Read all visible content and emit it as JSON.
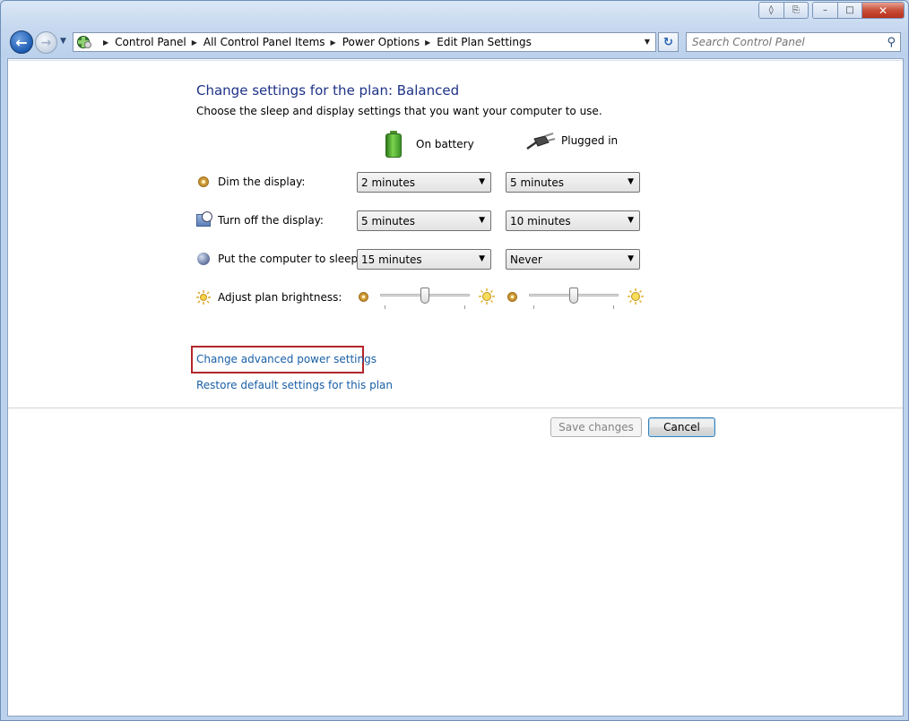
{
  "window": {
    "caption_extra": [
      "◊",
      "⎘"
    ],
    "caption_buttons": {
      "minimize": "–",
      "maximize": "□",
      "close": "✕"
    }
  },
  "nav": {
    "back_glyph": "←",
    "forward_glyph": "→",
    "recent_glyph": "▼",
    "breadcrumbs": [
      "Control Panel",
      "All Control Panel Items",
      "Power Options",
      "Edit Plan Settings"
    ],
    "refresh_glyph": "↻",
    "search_placeholder": "Search Control Panel",
    "search_icon": "⚲"
  },
  "main": {
    "title": "Change settings for the plan: Balanced",
    "subtitle": "Choose the sleep and display settings that you want your computer to use.",
    "columns": {
      "battery": "On battery",
      "plugged": "Plugged in"
    },
    "rows": [
      {
        "label": "Dim the display:",
        "icon": "dim-display-icon",
        "battery": "2 minutes",
        "plugged": "5 minutes"
      },
      {
        "label": "Turn off the display:",
        "icon": "display-off-icon",
        "battery": "5 minutes",
        "plugged": "10 minutes"
      },
      {
        "label": "Put the computer to sleep:",
        "icon": "sleep-icon",
        "battery": "15 minutes",
        "plugged": "Never"
      }
    ],
    "brightness_label": "Adjust plan brightness:",
    "brightness": {
      "battery": 0.5,
      "plugged": 0.5
    },
    "links": {
      "advanced": "Change advanced power settings",
      "restore": "Restore default settings for this plan"
    },
    "buttons": {
      "save": "Save changes",
      "cancel": "Cancel"
    },
    "dropdown_arrow": "▼"
  }
}
